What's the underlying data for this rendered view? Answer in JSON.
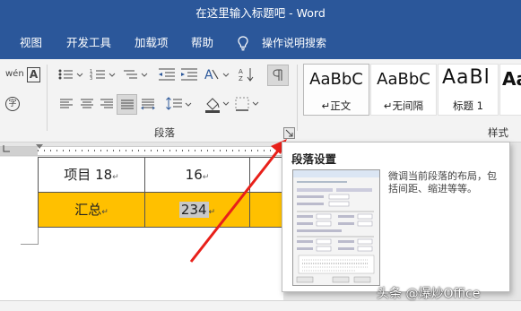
{
  "window": {
    "title": "在这里输入标题吧 - Word"
  },
  "menu": {
    "items": [
      "视图",
      "开发工具",
      "加载项",
      "帮助"
    ],
    "tell_me": "操作说明搜索"
  },
  "ribbon": {
    "font_icons": {
      "phonetic": "wén",
      "border_char": "A",
      "enclose_char": "字"
    },
    "groups": {
      "paragraph": "段落",
      "styles": "样式"
    },
    "styles": [
      {
        "sample": "AaBbC",
        "name": "↵正文"
      },
      {
        "sample": "AaBbC",
        "name": "↵无间隔"
      },
      {
        "sample": "AaBl",
        "name": "标题 1"
      },
      {
        "sample": "Aa",
        "name": ""
      }
    ]
  },
  "document": {
    "rows": [
      {
        "label": "项目 18",
        "mark": "↵",
        "value": "16",
        "value_mark": "↵"
      },
      {
        "label": "汇总",
        "mark": "↵",
        "value": "234",
        "value_mark": "↵"
      }
    ]
  },
  "tooltip": {
    "title": "段落设置",
    "description": "微调当前段落的布局，包括间距、缩进等等。"
  },
  "watermark": "头条 @爆炒Office",
  "colors": {
    "titlebar": "#2b579a",
    "ribbon": "#f3f3f3",
    "highlight_row": "#ffc000",
    "selection": "#c8c8c8",
    "arrow": "#e8201a"
  }
}
